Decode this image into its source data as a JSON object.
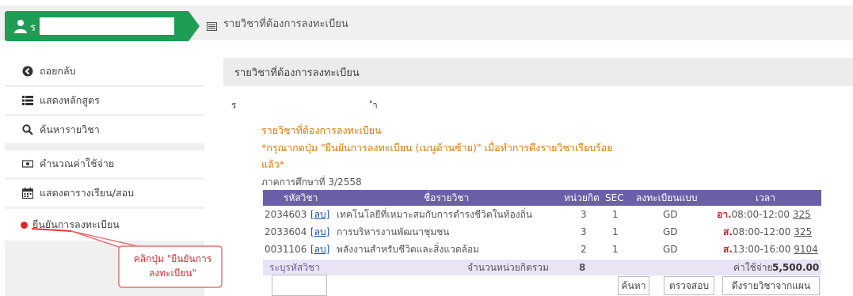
{
  "header": {
    "user_initial": "ร",
    "breadcrumb": "รายวิชาที่ต้องการลงทะเบียน"
  },
  "sidebar": {
    "items": [
      {
        "label": "ถอยกลับ",
        "icon": "back-circle-icon"
      },
      {
        "label": "แสดงหลักสูตร",
        "icon": "list-icon"
      },
      {
        "label": "ค้นหารายวิชา",
        "icon": "search-icon"
      },
      {
        "label": "คำนวณค่าใช้จ่าย",
        "icon": "money-icon"
      },
      {
        "label": "แสดงตารางเรียน/สอบ",
        "icon": "calendar-icon"
      },
      {
        "label": "ยืนยันการลงทะเบียน",
        "icon": "red-dot-icon"
      }
    ]
  },
  "callout": {
    "line1": "คลิกปุ่ม \"ยืนยันการ",
    "line2": "ลงทะเบียน\""
  },
  "panel": {
    "title": "รายวิชาที่ต้องการลงทะเบียน",
    "student_prefix": "ร",
    "student_suffix": "ำ",
    "notice_title": "รายวิชาที่ต้องการลงทะเบียน",
    "notice_line1": "*กรุณากดปุ่ม \"ยืนยันการลงทะเบียน (เมนูด้านซ้าย)\" เมื่อทำการดึงรายวิชาเรียบร้อย",
    "notice_line2": "แล้ว*",
    "term": "ภาคการศึกษาที่ 3/2558"
  },
  "table": {
    "headers": [
      "รหัสวิชา",
      "ชื่อรายวิชา",
      "หน่วยกิต",
      "SEC",
      "ลงทะเบียนแบบ",
      "เวลา"
    ],
    "rows": [
      {
        "code": "2034603",
        "del": "[ลบ]",
        "name": "เทคโนโลยีที่เหมาะสมกับการดำรงชีวิตในท้องถิ่น",
        "credit": "3",
        "sec": "1",
        "type": "GD",
        "day": "อา.",
        "time": "08:00-12:00",
        "room": "325"
      },
      {
        "code": "2033604",
        "del": "[ลบ]",
        "name": "การบริหารงานพัฒนาชุมชน",
        "credit": "3",
        "sec": "1",
        "type": "GD",
        "day": "ส.",
        "time": "08:00-12:00",
        "room": "325"
      },
      {
        "code": "0031106",
        "del": "[ลบ]",
        "name": "พลังงานสำหรับชีวิตและสิ่งแวดล้อม",
        "credit": "2",
        "sec": "1",
        "type": "GD",
        "day": "ส.",
        "time": "13:00-16:00",
        "room": "9104"
      }
    ],
    "footer": {
      "specify_code": "ระบุรหัสวิชา",
      "total_credit_label": "จำนวนหน่วยกิตรวม",
      "total_credit": "8",
      "cost_label": "ค่าใช้จ่าย",
      "cost": "5,500.00"
    }
  },
  "buttons": {
    "search": "ค้นหา",
    "check": "ตรวจสอบ",
    "pull": "ดึงรายวิชาจากแผน"
  },
  "colors": {
    "accent_green": "#1f9d55",
    "table_header": "#6b5fa8",
    "notice_orange": "#e07b00",
    "alert_red": "#e3262a"
  }
}
